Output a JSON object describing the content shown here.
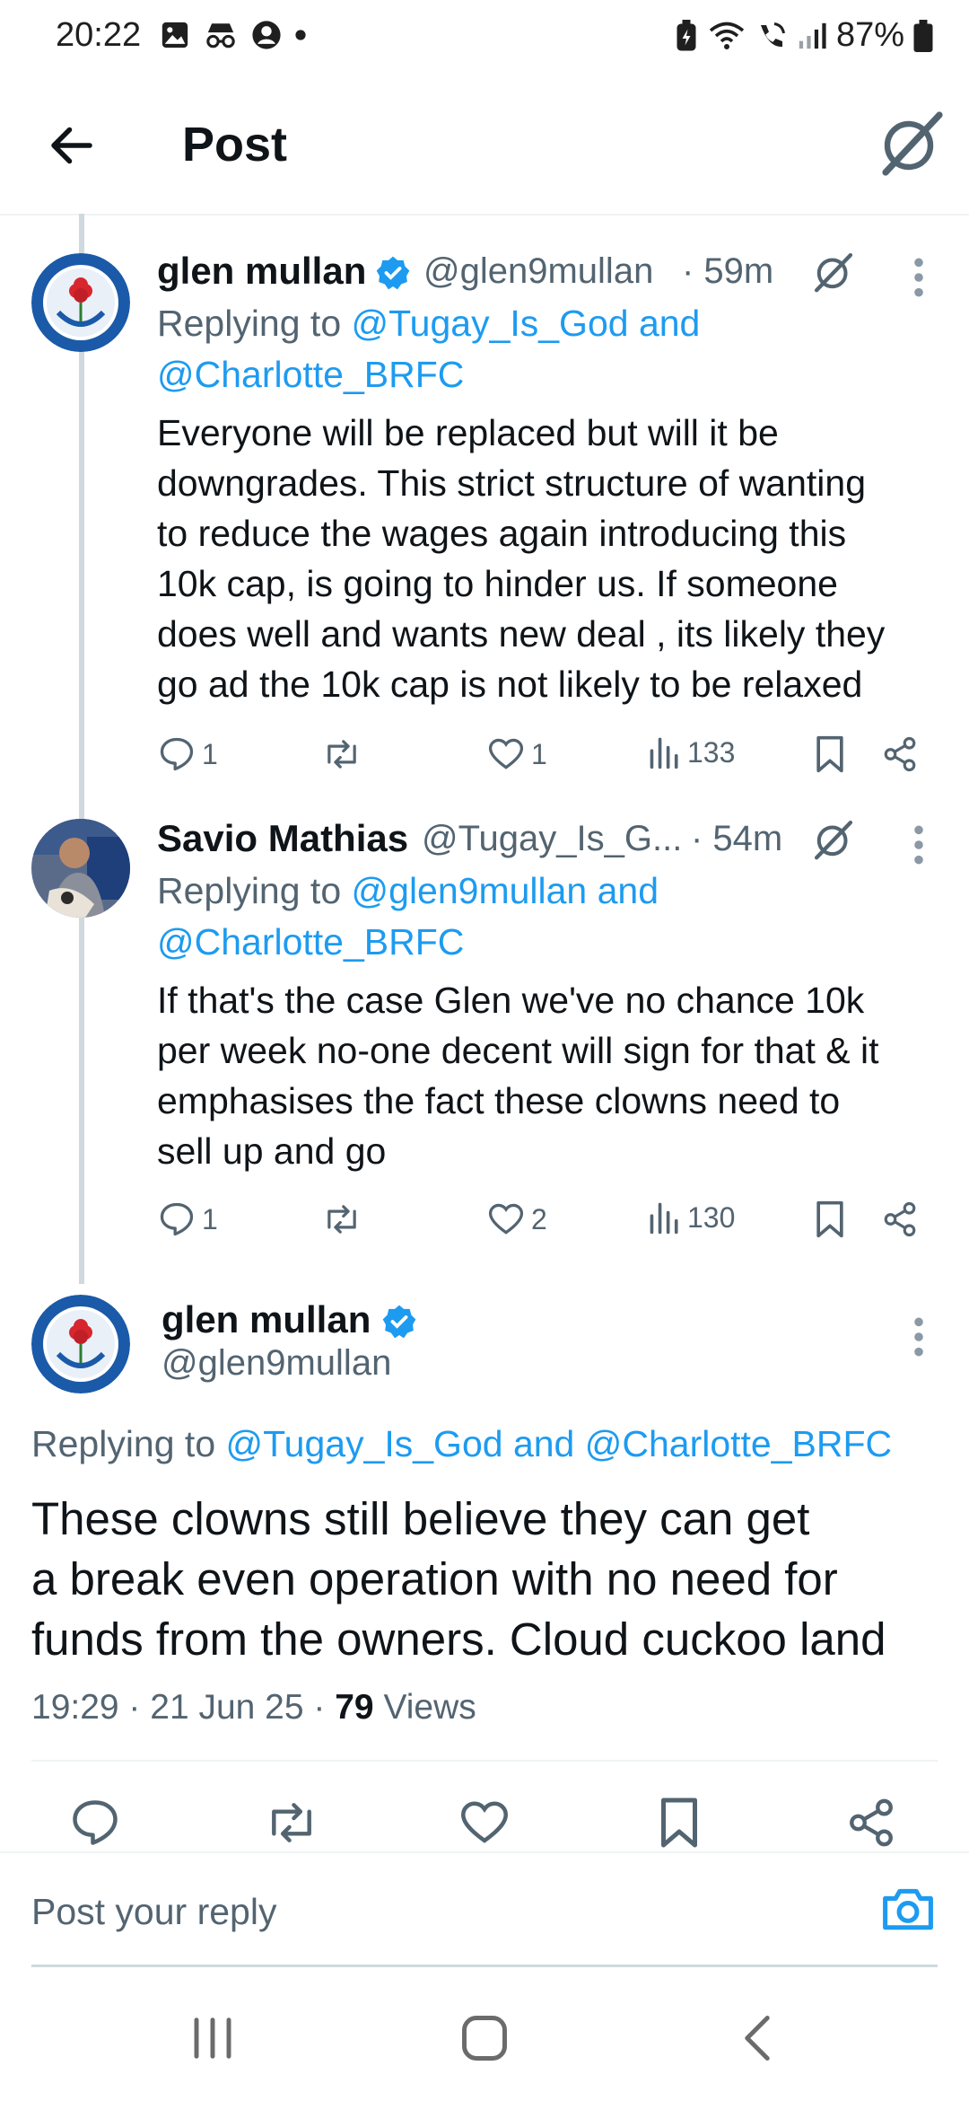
{
  "status_bar": {
    "time": "20:22",
    "battery": "87%",
    "icons_left": [
      "gallery-icon",
      "incognito-icon",
      "account-icon",
      "dot-icon"
    ],
    "icons_right": [
      "battery-saver-icon",
      "wifi-icon",
      "wifi-calling-icon",
      "signal-icon",
      "battery-icon"
    ]
  },
  "header": {
    "title": "Post"
  },
  "tweets": [
    {
      "name": "glen mullan",
      "handle": "@glen9mullan",
      "time": "· 59m",
      "verified": true,
      "reply_prefix": "Replying to ",
      "reply_line1": "@Tugay_Is_God and",
      "reply_line2": "@Charlotte_BRFC",
      "text_lines": [
        "Everyone will be replaced but will it be",
        "downgrades. This strict structure of wanting",
        "to reduce the wages again introducing this",
        "10k cap, is going to hinder us. If someone",
        "does well and wants new deal , its likely they",
        "go ad the 10k cap is not likely to be relaxed"
      ],
      "replies": "1",
      "reposts": "",
      "likes": "1",
      "views": "133"
    },
    {
      "name": "Savio Mathias",
      "handle": "@Tugay_Is_G...",
      "time": "· 54m",
      "verified": false,
      "reply_prefix": "Replying to ",
      "reply_line1": "@glen9mullan and",
      "reply_line2": "@Charlotte_BRFC",
      "text_lines": [
        "If that's the case Glen we've no chance 10k",
        "per week no-one decent will sign for that & it",
        "emphasises the fact these clowns need to",
        "sell up and go"
      ],
      "replies": "1",
      "reposts": "",
      "likes": "2",
      "views": "130"
    }
  ],
  "main_tweet": {
    "name": "glen mullan",
    "handle": "@glen9mullan",
    "reply_prefix": "Replying to ",
    "reply_to": "@Tugay_Is_God and @Charlotte_BRFC",
    "text_lines": [
      "These clowns still believe they can get",
      "a break even operation with no need for",
      "funds from the owners. Cloud cuckoo land"
    ],
    "timestamp": "19:29 · 21 Jun 25 · ",
    "views_count": "79",
    "views_label": " Views"
  },
  "reply_bar": {
    "placeholder": "Post your reply"
  },
  "colors": {
    "accent": "#1d9bf0",
    "secondary_text": "#536471",
    "primary_text": "#0f1419"
  }
}
